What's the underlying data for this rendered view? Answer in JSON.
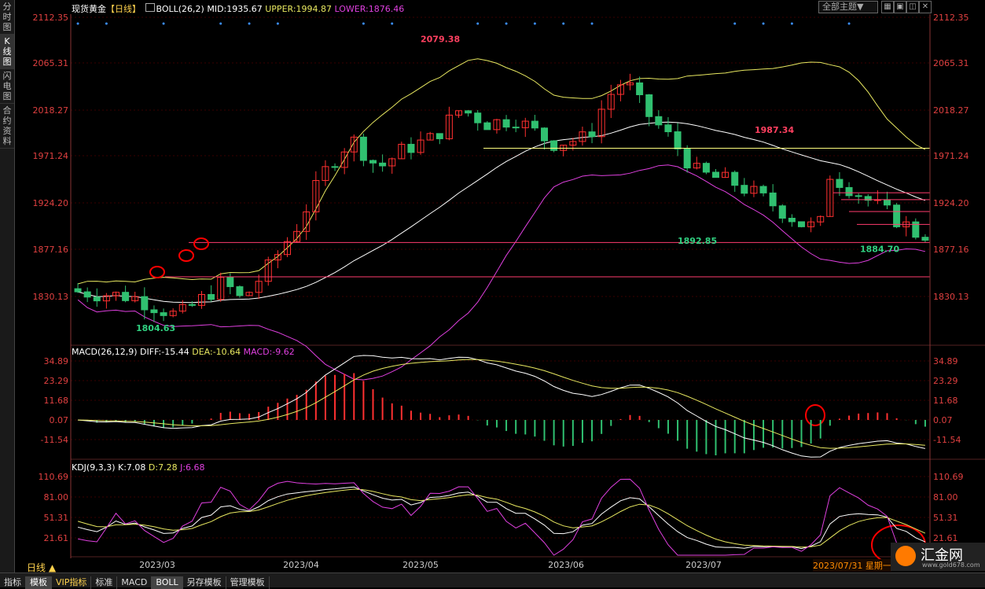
{
  "left_tabs": [
    {
      "label": "分时图"
    },
    {
      "label": "K线图",
      "active": true
    },
    {
      "label": "闪电图"
    },
    {
      "label": "合约资料"
    }
  ],
  "top_bar": {
    "title": "现货黄金",
    "period": "【日线】",
    "indicator": "BOLL(26,2)",
    "mid": "MID:1935.67",
    "upper": "UPPER:1994.87",
    "lower": "LOWER:1876.46",
    "theme_select": "全部主题▼"
  },
  "macd_header": {
    "name": "MACD(26,12,9)",
    "diff": "DIFF:-15.44",
    "dea": "DEA:-10.64",
    "macd": "MACD:-9.62"
  },
  "kdj_header": {
    "name": "KDJ(9,3,3)",
    "k": "K:7.08",
    "d": "D:7.28",
    "j": "J:6.68"
  },
  "bottom_tabs": [
    {
      "label": "指标"
    },
    {
      "label": "模板",
      "active": true
    },
    {
      "label": "VIP指标",
      "vip": true
    },
    {
      "label": "标准"
    },
    {
      "label": "MACD"
    },
    {
      "label": "BOLL",
      "active": true
    },
    {
      "label": "另存模板"
    },
    {
      "label": "管理模板"
    }
  ],
  "period_label": "日线 ▲",
  "date_readout": "2023/07/31 星期一",
  "watermark": "汇金网",
  "watermark_sub": "www.gold678.com",
  "colors": {
    "up": "#ff3030",
    "down": "#30c070",
    "upper": "#e8e860",
    "mid": "#ffffff",
    "lower": "#e040e0",
    "axis": "#e04040",
    "grid": "#3a0000",
    "hline": "#ff3c6e",
    "annot": "#ff0000"
  },
  "chart_data": [
    {
      "type": "candlestick",
      "title": "现货黄金 日线",
      "yticks": [
        "2112.35",
        "2065.31",
        "2018.27",
        "1971.24",
        "1924.20",
        "1877.16",
        "1830.13"
      ],
      "ylim": [
        1780,
        2120
      ],
      "xticks": [
        "2023/03",
        "2023/04",
        "2023/05",
        "2023/06",
        "2023/07"
      ],
      "annotations": [
        "2079.38",
        "1987.34",
        "1892.85",
        "1884.70",
        "1804.63"
      ],
      "overlays": [
        "UPPER",
        "MID",
        "LOWER"
      ]
    },
    {
      "type": "bar",
      "title": "MACD(26,12,9)",
      "yticks": [
        "34.89",
        "23.29",
        "11.68",
        "0.07",
        "-11.54"
      ],
      "ylim": [
        -22,
        39
      ],
      "series": [
        {
          "name": "DIFF"
        },
        {
          "name": "DEA"
        },
        {
          "name": "MACD"
        }
      ]
    },
    {
      "type": "line",
      "title": "KDJ(9,3,3)",
      "yticks": [
        "110.69",
        "81.00",
        "51.31",
        "21.61"
      ],
      "ylim": [
        -5,
        120
      ],
      "series": [
        {
          "name": "K"
        },
        {
          "name": "D"
        },
        {
          "name": "J"
        }
      ]
    }
  ]
}
